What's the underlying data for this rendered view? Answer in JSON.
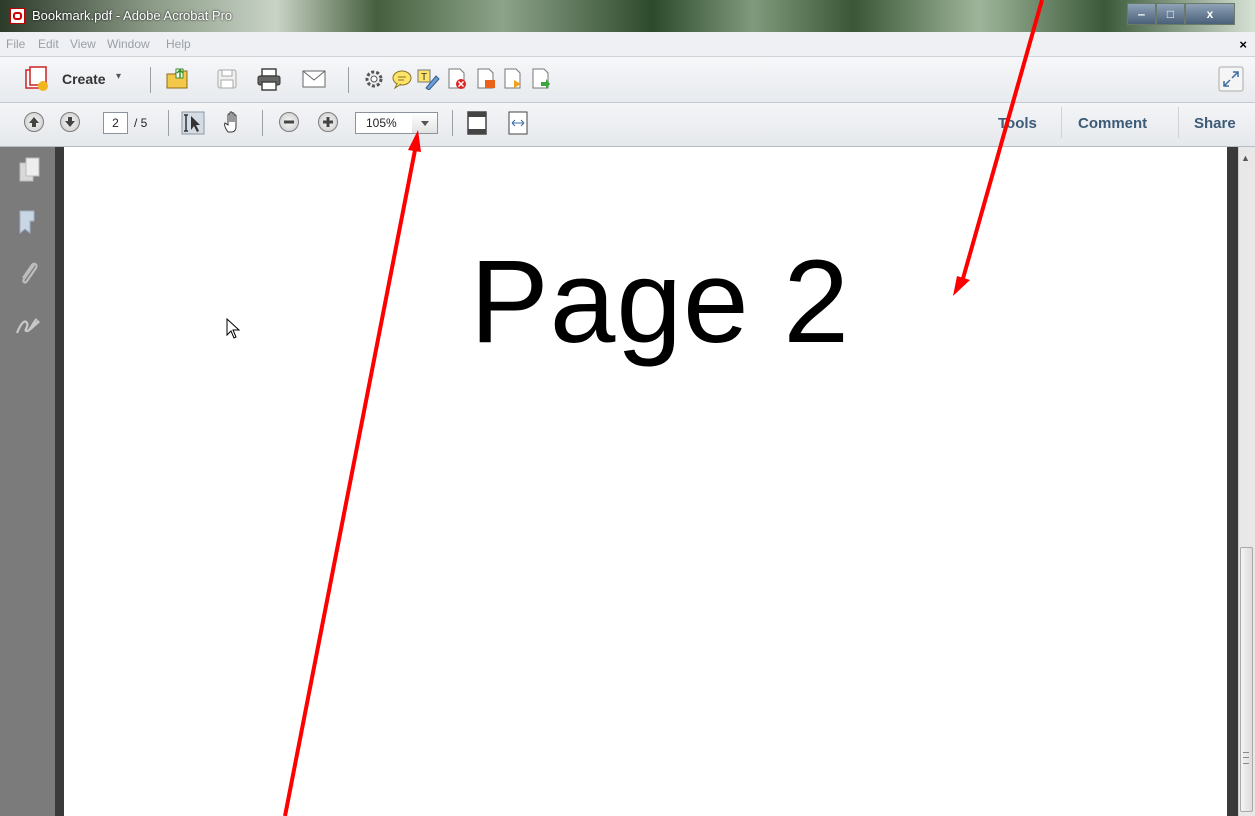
{
  "window": {
    "title": "Bookmark.pdf - Adobe Acrobat Pro",
    "minimize_label": "‒",
    "maximize_label": "□",
    "close_label": "x"
  },
  "menu": {
    "items": [
      "File",
      "Edit",
      "View",
      "Window",
      "Help"
    ],
    "close_doc_label": "×"
  },
  "toolbar": {
    "create_label": "Create",
    "create_caret": "▾"
  },
  "nav": {
    "current_page": "2",
    "total_pages": "/ 5",
    "zoom": "105%"
  },
  "right_panels": {
    "tools": "Tools",
    "comment": "Comment",
    "share": "Share"
  },
  "document": {
    "page_text": "Page 2"
  },
  "annotation_color": "#ff0000"
}
